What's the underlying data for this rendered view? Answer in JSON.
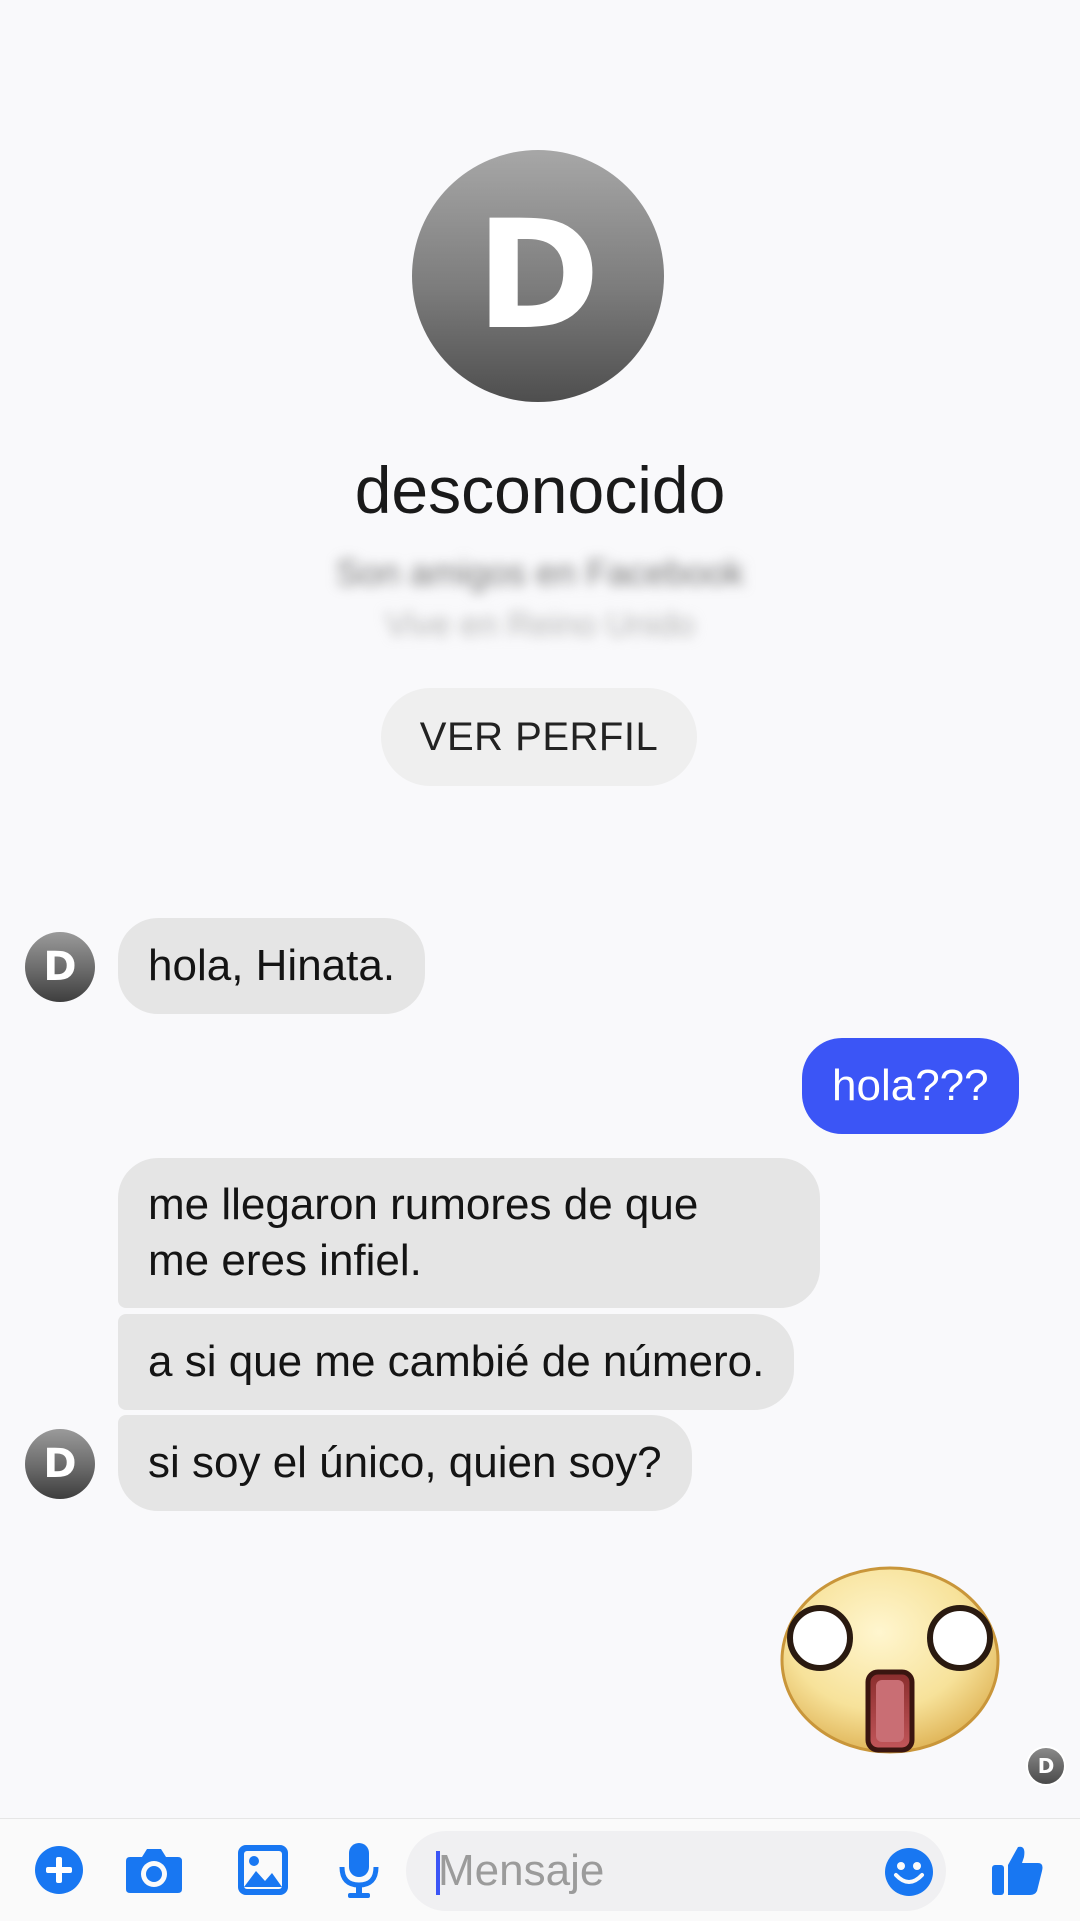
{
  "profile": {
    "initial": "D",
    "name": "desconocido",
    "blurred_line_1": "Son amigos en Facebook",
    "blurred_line_2": "Vive en Reino Unido",
    "view_profile_label": "VER PERFIL"
  },
  "messages": [
    {
      "direction": "in",
      "text": "hola, Hinata."
    },
    {
      "direction": "out",
      "text": "hola???"
    },
    {
      "direction": "in",
      "text": "me llegaron rumores de que\nme eres infiel."
    },
    {
      "direction": "in",
      "text": "a si que me cambié de número."
    },
    {
      "direction": "in",
      "text": "si soy el único, quien soy?"
    }
  ],
  "avatar_initial": "D",
  "sticker": "shocked-face-sticker",
  "composer": {
    "placeholder": "Mensaje",
    "icons": [
      "plus-icon",
      "camera-icon",
      "image-icon",
      "microphone-icon",
      "emoji-icon",
      "thumbs-up-icon"
    ]
  },
  "colors": {
    "accent": "#3b55f6",
    "incoming_bubble": "#e5e5e5",
    "icon_blue": "#1877f2"
  }
}
